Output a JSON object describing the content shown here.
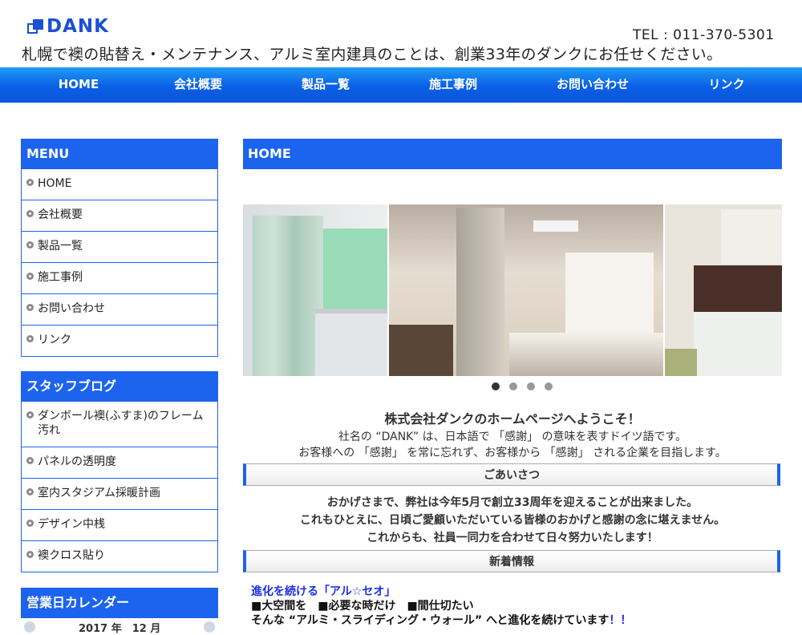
{
  "header": {
    "logo_text": "DANK",
    "tel": "TEL : 011-370-5301",
    "tagline": "札幌で襖の貼替え・メンテナンス、アルミ室内建具のことは、創業33年のダンクにお任せください。"
  },
  "nav": [
    "HOME",
    "会社概要",
    "製品一覧",
    "施工事例",
    "お問い合わせ",
    "リンク"
  ],
  "menu": {
    "title": "MENU",
    "items": [
      "HOME",
      "会社概要",
      "製品一覧",
      "施工事例",
      "お問い合わせ",
      "リンク"
    ]
  },
  "blog": {
    "title": "スタッフブログ",
    "items": [
      "ダンボール襖(ふすま)のフレーム汚れ",
      "パネルの透明度",
      "室内スタジアム採暖計画",
      "デザイン中桟",
      "襖クロス貼り"
    ]
  },
  "calendar": {
    "title": "営業日カレンダー",
    "month_label": "2017 年　12 月"
  },
  "main": {
    "title": "HOME",
    "welcome_title": "株式会社ダンクのホームページへようこそ！",
    "welcome_line1": "社名の “DANK” は、日本語で 「感謝」 の意味を表すドイツ語です。",
    "welcome_line2": "お客様への 「感謝」 を常に忘れず、お客様から 「感謝」 される企業を目指します。",
    "greeting_title": "ごあいさつ",
    "greeting_lines": [
      "おかげさまで、弊社は今年5月で創立33周年を迎えることが出来ました。",
      "これもひとえに、日頃ご愛顧いただいている皆様のおかげと感謝の念に堪えません。",
      "これからも、社員一同力を合わせて日々努力いたします！"
    ],
    "news_title": "新着情報",
    "news_heading": "進化を続ける「アル☆セオ」",
    "news_line1": "■大空間を　■必要な時だけ　■間仕切たい",
    "news_line2": "そんな “アルミ・スライディング・ウォール” へと進化を続けています",
    "news_line2_mark": "！！",
    "slider_dots": 4,
    "slider_active": 1
  },
  "colors": {
    "brand_blue": "#1c63ee",
    "nav_gradient_top": "#1f9bf4"
  }
}
